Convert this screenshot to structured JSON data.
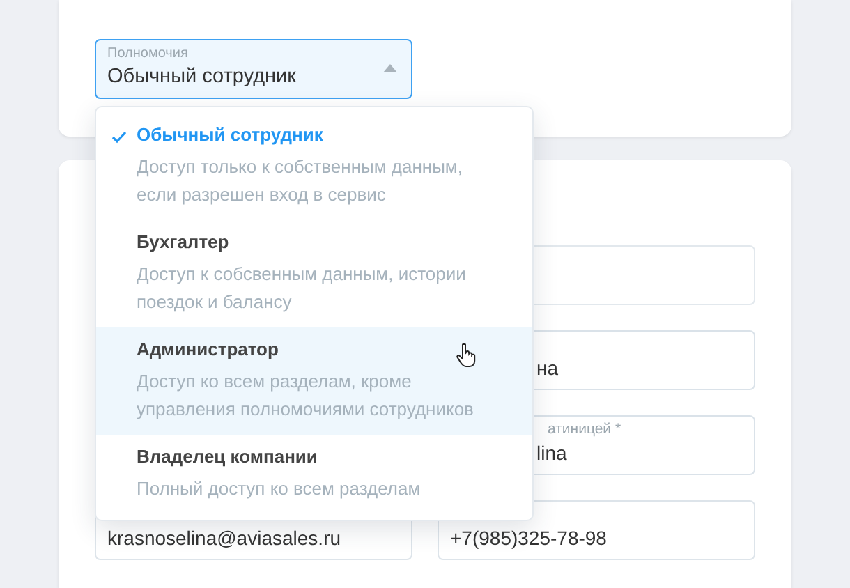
{
  "role_select": {
    "label": "Полномочия",
    "value": "Обычный сотрудник",
    "expanded": true
  },
  "role_options": [
    {
      "title": "Обычный сотрудник",
      "description": "Доступ только к собственным данным, если разрешен вход в сервис",
      "selected": true,
      "highlighted": false
    },
    {
      "title": "Бухгалтер",
      "description": "Доступ к собсвенным данным, истории поездок и балансу",
      "selected": false,
      "highlighted": false
    },
    {
      "title": "Администратор",
      "description": "Доступ ко всем разделам, кроме управления полномочиями сотрудников",
      "selected": false,
      "highlighted": true
    },
    {
      "title": "Владелец компании",
      "description": "Полный доступ ко всем разделам",
      "selected": false,
      "highlighted": false
    }
  ],
  "right_fields": [
    {
      "kind": "blank"
    },
    {
      "kind": "filled",
      "value": "на"
    },
    {
      "kind": "filled",
      "label": "атиницей *",
      "value": "lina"
    }
  ],
  "bottom_fields": [
    {
      "value": "krasnoselina@aviasales.ru"
    },
    {
      "value": "+7(985)325-78-98"
    }
  ]
}
